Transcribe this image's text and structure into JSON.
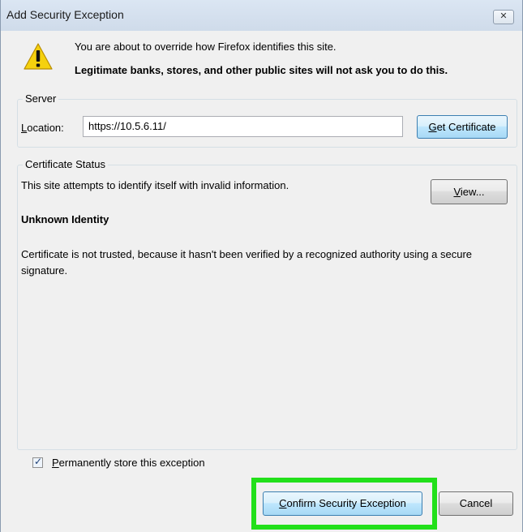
{
  "window": {
    "title": "Add Security Exception",
    "close_glyph": "✕"
  },
  "message": {
    "line1": "You are about to override how Firefox identifies this site.",
    "line2": "Legitimate banks, stores, and other public sites will not ask you to do this.",
    "icon": "warning-icon"
  },
  "server": {
    "group_label": "Server",
    "location_label_accel": "L",
    "location_label_rest": "ocation:",
    "location_value": "https://10.5.6.11/",
    "get_cert_accel": "G",
    "get_cert_rest": "et Certificate"
  },
  "status": {
    "group_label": "Certificate Status",
    "summary": "This site attempts to identify itself with invalid information.",
    "view_accel": "V",
    "view_rest": "iew...",
    "heading": "Unknown Identity",
    "detail": "Certificate is not trusted, because it hasn't been verified by a recognized authority using a secure signature."
  },
  "options": {
    "permanent_checked": true,
    "permanent_accel": "P",
    "permanent_rest": "ermanently store this exception"
  },
  "buttons": {
    "confirm_accel": "C",
    "confirm_rest": "onfirm Security Exception",
    "cancel": "Cancel"
  },
  "colors": {
    "highlight": "#22e01a",
    "warning_yellow": "#f5d10e"
  }
}
